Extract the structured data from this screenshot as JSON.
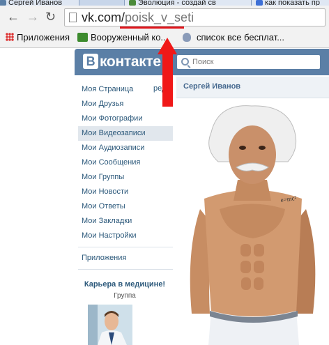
{
  "browser": {
    "tabs": [
      {
        "label": "Сергей Иванов",
        "icon": "vk-icon"
      },
      {
        "label": "Эволюция - создай св",
        "icon": "evolution-game-icon"
      },
      {
        "label": "как показать пр",
        "icon": "google-icon"
      }
    ],
    "url_host": "vk.com/",
    "url_path": "poisk_v_seti",
    "bookmarks": [
      {
        "label": "Приложения",
        "icon": "apps-grid-icon"
      },
      {
        "label": "Вооруженный ко...",
        "icon": "game-icon"
      },
      {
        "label": "список все бесплат...",
        "icon": "bookmark-icon"
      }
    ]
  },
  "vk": {
    "logo": "контакте",
    "logo_badge": "В",
    "search_placeholder": "Поиск",
    "edit_link": "ред.",
    "menu": [
      "Моя Страница",
      "Мои Друзья",
      "Мои Фотографии",
      "Мои Видеозаписи",
      "Мои Аудиозаписи",
      "Мои Сообщения",
      "Мои Группы",
      "Мои Новости",
      "Мои Ответы",
      "Мои Закладки",
      "Мои Настройки"
    ],
    "active_menu_index": 3,
    "apps_link": "Приложения",
    "promo": {
      "title": "Карьера в медицине!",
      "subtitle": "Группа"
    },
    "profile_name": "Сергей Иванов",
    "photo_tattoo": "e=mc²"
  },
  "colors": {
    "vk_blue": "#5b7fa6",
    "link": "#2b587a",
    "annotation_red": "#f01818"
  }
}
